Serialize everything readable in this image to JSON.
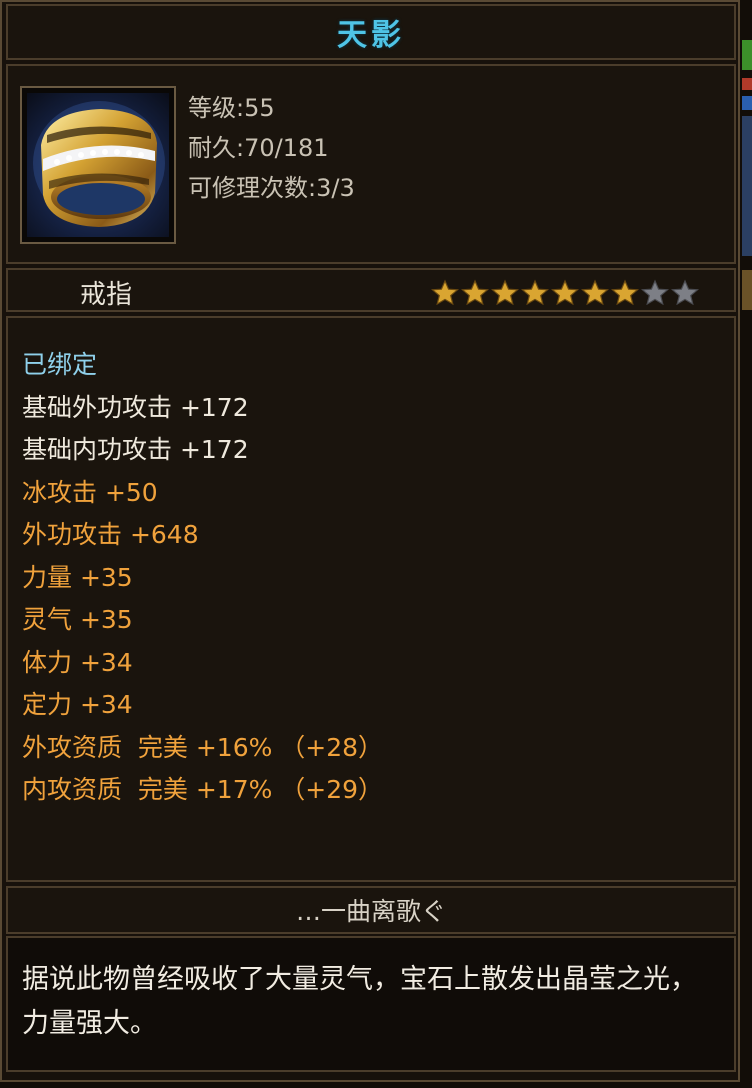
{
  "item": {
    "name": "天影",
    "icon": "ring-icon",
    "level_text": "等级:55",
    "durability_text": "耐久:70/181",
    "repair_text": "可修理次数:3/3",
    "type": "戒指",
    "stars_filled": 7,
    "stars_total": 9
  },
  "stats": [
    {
      "text": "已绑定",
      "color": "bind"
    },
    {
      "text": "基础外功攻击 +172",
      "color": "white"
    },
    {
      "text": "基础内功攻击 +172",
      "color": "white"
    },
    {
      "text": "冰攻击 +50",
      "color": "orange"
    },
    {
      "text": "外功攻击 +648",
      "color": "orange"
    },
    {
      "text": "力量 +35",
      "color": "orange"
    },
    {
      "text": "灵气 +35",
      "color": "orange"
    },
    {
      "text": "体力 +34",
      "color": "orange"
    },
    {
      "text": "定力 +34",
      "color": "orange"
    },
    {
      "text": "外攻资质  完美 +16% （+28）",
      "color": "orange"
    },
    {
      "text": "内攻资质  完美 +17% （+29）",
      "color": "orange"
    }
  ],
  "author": "…一曲离歌ぐ",
  "description": "据说此物曾经吸收了大量灵气，宝石上散发出晶莹之光，力量强大。",
  "colors": {
    "title": "#4fc4e6",
    "bind": "#8fd0ea",
    "white": "#efe9dd",
    "orange": "#f0a23c",
    "star_gold": "#d9a531",
    "star_empty": "#7d7f86"
  }
}
